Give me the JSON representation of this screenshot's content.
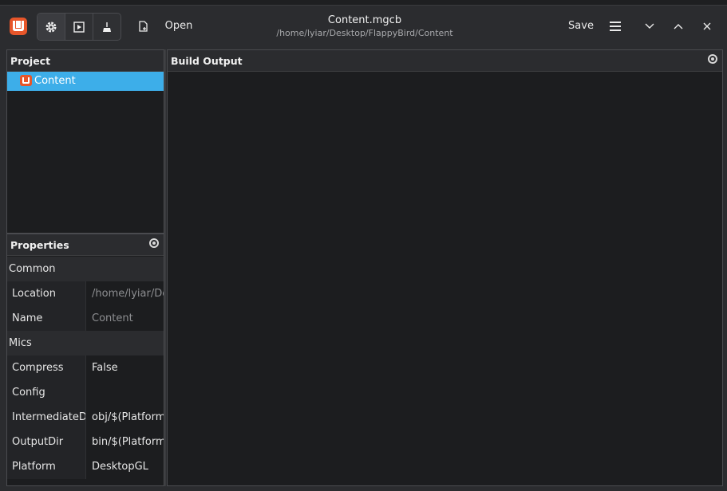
{
  "header": {
    "title": "Content.mgcb",
    "path": "/home/lyiar/Desktop/FlappyBird/Content",
    "open_label": "Open",
    "save_label": "Save",
    "icons": {
      "app": "monogame-logo-icon",
      "settings": "gear-icon",
      "build": "build-icon",
      "clean": "broom-icon",
      "new": "new-file-icon",
      "menu": "hamburger-menu-icon",
      "minimize": "chevron-down-icon",
      "maximize": "chevron-up-icon",
      "close": "close-icon"
    }
  },
  "project": {
    "heading": "Project",
    "items": [
      {
        "label": "Content",
        "icon": "monogame-logo-icon",
        "selected": true
      }
    ]
  },
  "properties": {
    "heading": "Properties",
    "groups": [
      {
        "label": "Common",
        "rows": [
          {
            "name": "Location",
            "value": "/home/lyiar/Desktop/FlappyBird/Content",
            "dim": true
          },
          {
            "name": "Name",
            "value": "Content",
            "dim": true
          }
        ]
      },
      {
        "label": "Mics",
        "rows": [
          {
            "name": "Compress",
            "value": "False"
          },
          {
            "name": "Config",
            "value": ""
          },
          {
            "name": "IntermediateDir",
            "value": "obj/$(Platform)"
          },
          {
            "name": "OutputDir",
            "value": "bin/$(Platform)"
          },
          {
            "name": "Platform",
            "value": "DesktopGL"
          }
        ]
      }
    ]
  },
  "build_output": {
    "heading": "Build Output",
    "text": ""
  },
  "colors": {
    "accent": "#3daee9",
    "brand": "#e7562a",
    "panel_bg": "#1c1d1f",
    "chrome_bg": "#2b2c2f"
  }
}
